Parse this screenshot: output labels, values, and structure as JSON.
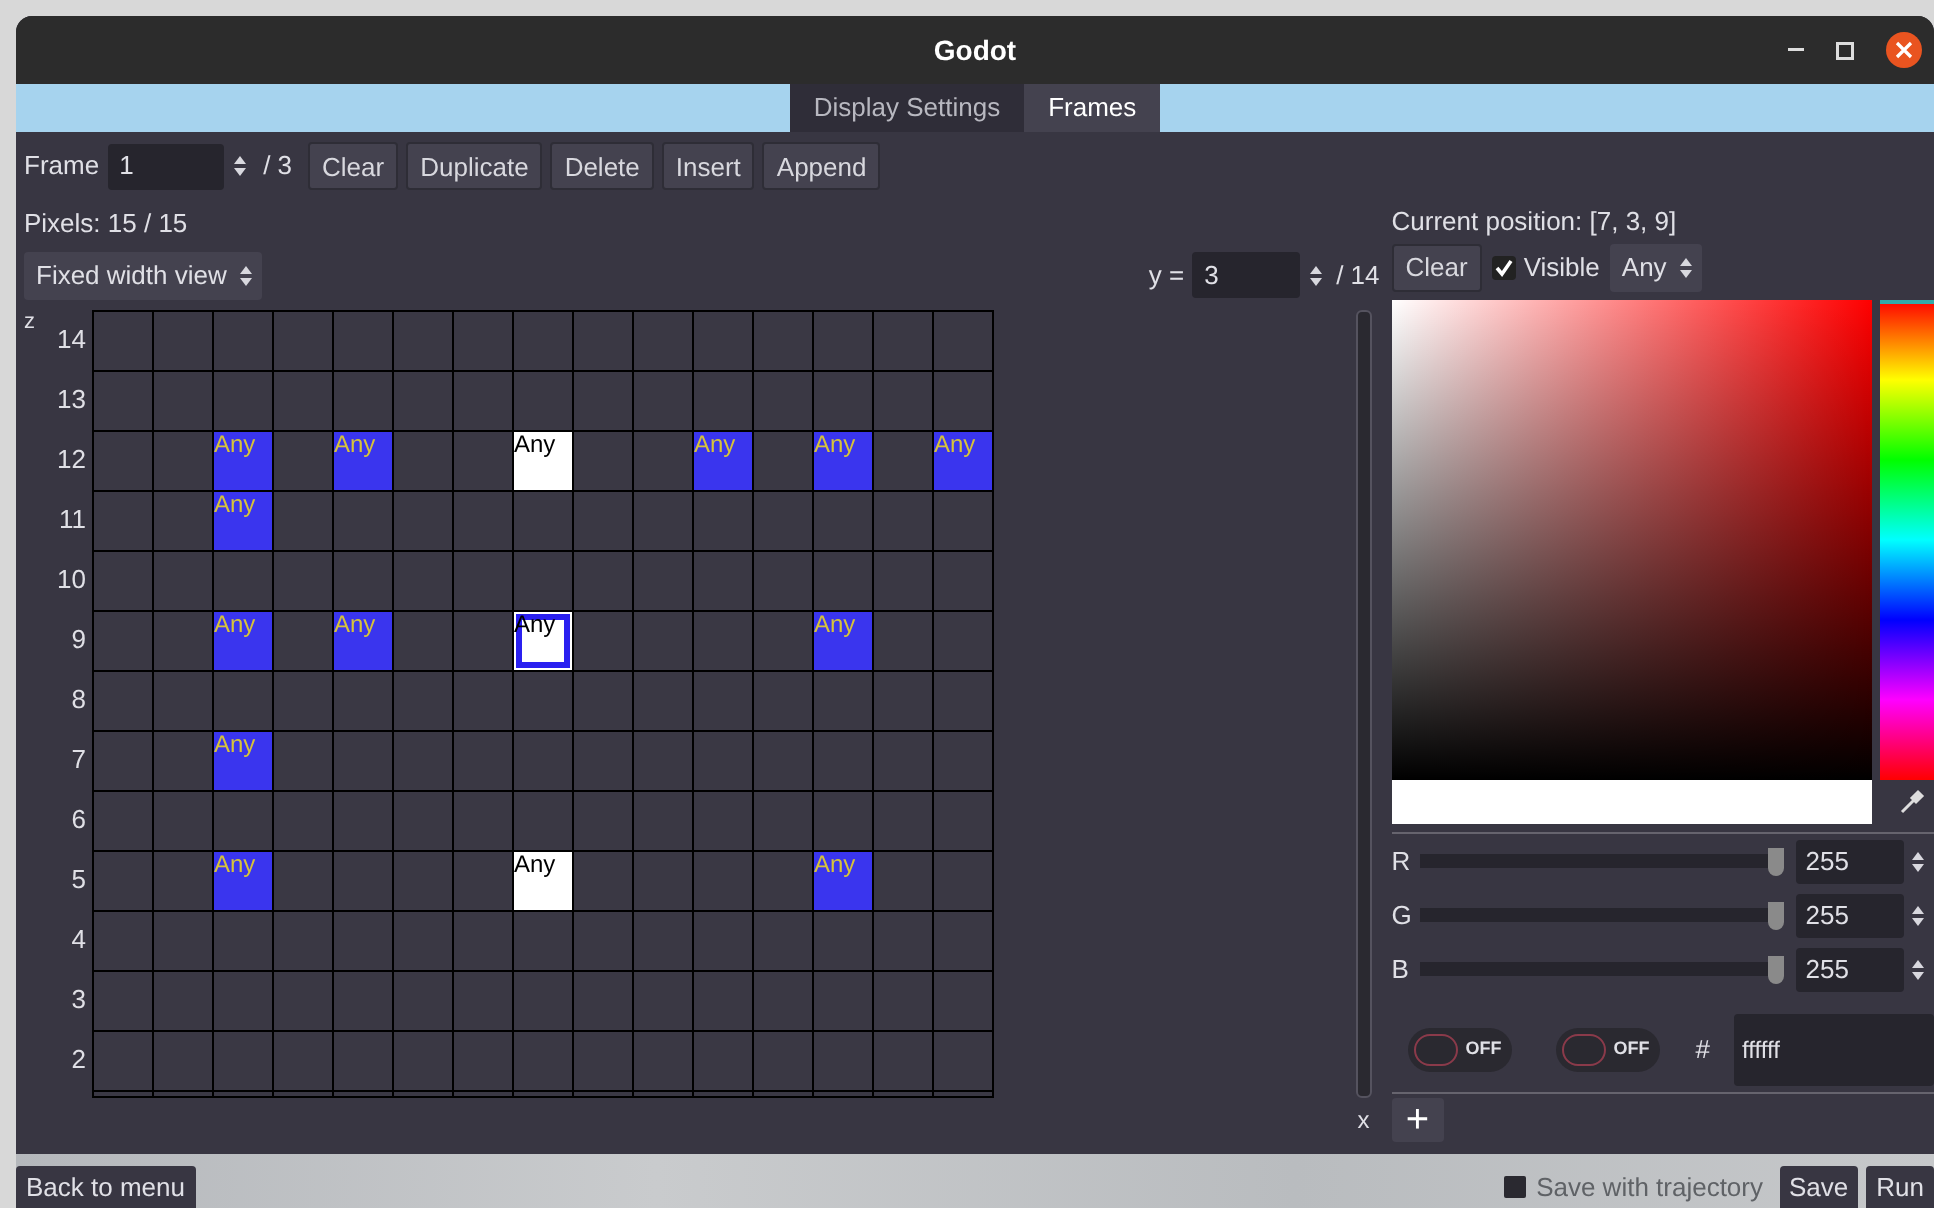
{
  "window": {
    "title": "Godot"
  },
  "tabs": [
    {
      "label": "Display Settings",
      "selected": false
    },
    {
      "label": "Frames",
      "selected": true
    }
  ],
  "frame_toolbar": {
    "label": "Frame",
    "value": "1",
    "total": "/ 3",
    "buttons": [
      "Clear",
      "Duplicate",
      "Delete",
      "Insert",
      "Append"
    ]
  },
  "pixels": "Pixels: 15 / 15",
  "view_select": {
    "value": "Fixed width view"
  },
  "y_field": {
    "label": "y =",
    "value": "3",
    "total": "/ 14"
  },
  "grid": {
    "axis_label": "z",
    "x_label": "x",
    "rows": [
      {
        "label": "14",
        "cells": [
          null,
          null,
          null,
          null,
          null,
          null,
          null,
          null,
          null,
          null,
          null,
          null,
          null,
          null,
          null
        ]
      },
      {
        "label": "13",
        "cells": [
          null,
          null,
          null,
          null,
          null,
          null,
          null,
          null,
          null,
          null,
          null,
          null,
          null,
          null,
          null
        ]
      },
      {
        "label": "12",
        "cells": [
          null,
          null,
          {
            "label": "Any",
            "color": "#3a35ee",
            "selected": false
          },
          null,
          {
            "label": "Any",
            "color": "#3a35ee",
            "selected": false
          },
          null,
          null,
          {
            "label": "Any",
            "color": "#ffffff",
            "selected": false
          },
          null,
          null,
          {
            "label": "Any",
            "color": "#3a35ee",
            "selected": false
          },
          null,
          {
            "label": "Any",
            "color": "#3a35ee",
            "selected": false
          },
          null,
          {
            "label": "Any",
            "color": "#3a35ee",
            "selected": false
          }
        ]
      },
      {
        "label": "11",
        "cells": [
          null,
          null,
          {
            "label": "Any",
            "color": "#3a35ee",
            "selected": false
          },
          null,
          null,
          null,
          null,
          null,
          null,
          null,
          null,
          null,
          null,
          null,
          null
        ]
      },
      {
        "label": "10",
        "cells": [
          null,
          null,
          null,
          null,
          null,
          null,
          null,
          null,
          null,
          null,
          null,
          null,
          null,
          null,
          null
        ]
      },
      {
        "label": "9",
        "cells": [
          null,
          null,
          {
            "label": "Any",
            "color": "#3a35ee",
            "selected": false
          },
          null,
          {
            "label": "Any",
            "color": "#3a35ee",
            "selected": false
          },
          null,
          null,
          {
            "label": "Any",
            "color": "#ffffff",
            "selected": true
          },
          null,
          null,
          null,
          null,
          {
            "label": "Any",
            "color": "#3a35ee",
            "selected": false
          },
          null,
          null
        ]
      },
      {
        "label": "8",
        "cells": [
          null,
          null,
          null,
          null,
          null,
          null,
          null,
          null,
          null,
          null,
          null,
          null,
          null,
          null,
          null
        ]
      },
      {
        "label": "7",
        "cells": [
          null,
          null,
          {
            "label": "Any",
            "color": "#3a35ee",
            "selected": false
          },
          null,
          null,
          null,
          null,
          null,
          null,
          null,
          null,
          null,
          null,
          null,
          null
        ]
      },
      {
        "label": "6",
        "cells": [
          null,
          null,
          null,
          null,
          null,
          null,
          null,
          null,
          null,
          null,
          null,
          null,
          null,
          null,
          null
        ]
      },
      {
        "label": "5",
        "cells": [
          null,
          null,
          {
            "label": "Any",
            "color": "#3a35ee",
            "selected": false
          },
          null,
          null,
          null,
          null,
          {
            "label": "Any",
            "color": "#ffffff",
            "selected": false
          },
          null,
          null,
          null,
          null,
          {
            "label": "Any",
            "color": "#3a35ee",
            "selected": false
          },
          null,
          null
        ]
      },
      {
        "label": "4",
        "cells": [
          null,
          null,
          null,
          null,
          null,
          null,
          null,
          null,
          null,
          null,
          null,
          null,
          null,
          null,
          null
        ]
      },
      {
        "label": "3",
        "cells": [
          null,
          null,
          null,
          null,
          null,
          null,
          null,
          null,
          null,
          null,
          null,
          null,
          null,
          null,
          null
        ]
      },
      {
        "label": "2",
        "cells": [
          null,
          null,
          null,
          null,
          null,
          null,
          null,
          null,
          null,
          null,
          null,
          null,
          null,
          null,
          null
        ]
      }
    ]
  },
  "inspector": {
    "position": "Current position: [7, 3, 9]",
    "clear": "Clear",
    "visible": {
      "label": "Visible",
      "checked": true
    },
    "select": {
      "value": "Any"
    }
  },
  "color_picker": {
    "color": "#ffffff",
    "hue": {
      "level": 0
    },
    "channels": [
      {
        "name": "R",
        "level": 1,
        "value": "255"
      },
      {
        "name": "G",
        "level": 1,
        "value": "255"
      },
      {
        "name": "B",
        "level": 1,
        "value": "255"
      }
    ],
    "toggles": [
      {
        "label": "OFF",
        "on": false
      },
      {
        "label": "OFF",
        "on": false
      }
    ],
    "hash": "#",
    "hex": "ffffff",
    "add": "+"
  },
  "footer": {
    "back": "Back to menu",
    "save_trajectory": {
      "label": "Save with trajectory",
      "checked": false
    },
    "buttons": [
      "Save",
      "Run"
    ]
  }
}
